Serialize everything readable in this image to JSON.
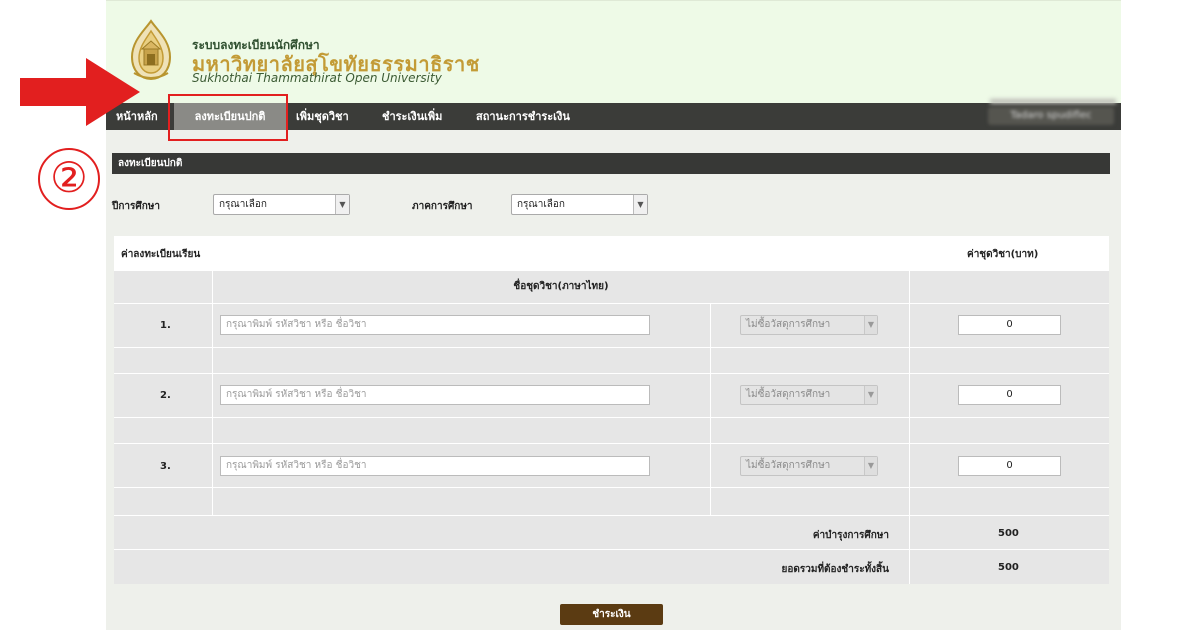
{
  "header": {
    "title_th_small": "ระบบลงทะเบียนนักศึกษา",
    "title_th_large": "มหาวิทยาลัยสุโขทัยธรรมาธิราช",
    "title_en": "Sukhothai Thammathirat Open University"
  },
  "nav": {
    "home": "หน้าหลัก",
    "register": "ลงทะเบียนปกติ",
    "add_course": "เพิ่มชุดวิชา",
    "extra_payment": "ชำระเงินเพิ่ม",
    "payment_status": "สถานะการชำระเงิน",
    "user": "Tadaro spudiflec"
  },
  "section": {
    "title": "ลงทะเบียนปกติ"
  },
  "filters": {
    "year_label": "ปีการศึกษา",
    "year_value": "กรุณาเลือก",
    "term_label": "ภาคการศึกษา",
    "term_value": "กรุณาเลือก"
  },
  "table": {
    "head_left": "ค่าลงทะเบียนเรียน",
    "head_right": "ค่าชุดวิชา(บาท)",
    "col_course": "ชื่อชุดวิชา(ภาษาไทย)",
    "rows": [
      {
        "num": "1.",
        "placeholder": "กรุณาพิมพ์ รหัสวิชา หรือ ชื่อวิชา",
        "material": "ไม่ซื้อวัสดุการศึกษา",
        "fee": "0"
      },
      {
        "num": "2.",
        "placeholder": "กรุณาพิมพ์ รหัสวิชา หรือ ชื่อวิชา",
        "material": "ไม่ซื้อวัสดุการศึกษา",
        "fee": "0"
      },
      {
        "num": "3.",
        "placeholder": "กรุณาพิมพ์ รหัสวิชา หรือ ชื่อวิชา",
        "material": "ไม่ซื้อวัสดุการศึกษา",
        "fee": "0"
      }
    ],
    "maintenance_label": "ค่าบำรุงการศึกษา",
    "maintenance_value": "500",
    "total_label": "ยอดรวมที่ต้องชำระทั้งสิ้น",
    "total_value": "500"
  },
  "actions": {
    "pay": "ชำระเงิน"
  },
  "annotation": {
    "step": "②"
  },
  "colors": {
    "annotation_red": "#e21f1f",
    "nav_bg": "#3b3c39",
    "brand_gold": "#c39b36",
    "pay_button": "#5b3b12"
  }
}
